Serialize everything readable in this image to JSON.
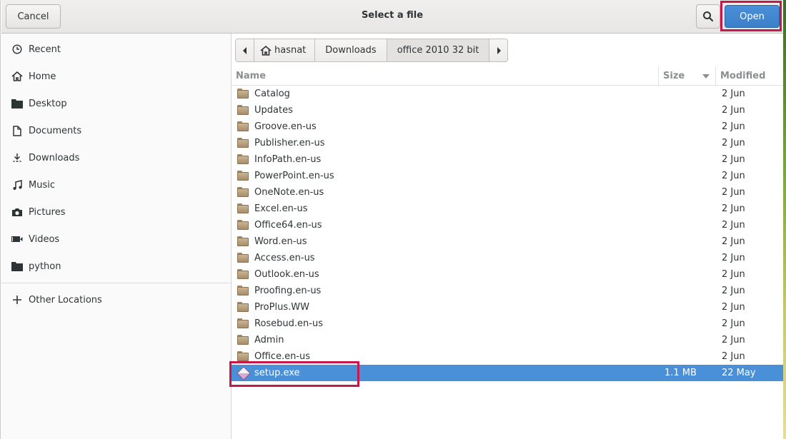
{
  "header": {
    "title": "Select a file",
    "cancel_label": "Cancel",
    "open_label": "Open",
    "search_icon": "search-icon"
  },
  "sidebar": {
    "items": [
      {
        "label": "Recent",
        "icon": "clock-icon"
      },
      {
        "label": "Home",
        "icon": "home-icon"
      },
      {
        "label": "Desktop",
        "icon": "folder-icon"
      },
      {
        "label": "Documents",
        "icon": "document-icon"
      },
      {
        "label": "Downloads",
        "icon": "download-icon"
      },
      {
        "label": "Music",
        "icon": "music-icon"
      },
      {
        "label": "Pictures",
        "icon": "camera-icon"
      },
      {
        "label": "Videos",
        "icon": "video-icon"
      },
      {
        "label": "python",
        "icon": "folder-icon"
      }
    ],
    "other_locations": {
      "label": "Other Locations",
      "icon": "plus-icon"
    }
  },
  "pathbar": {
    "crumbs": [
      "hasnat",
      "Downloads",
      "office 2010 32 bit"
    ]
  },
  "columns": {
    "name": "Name",
    "size": "Size",
    "modified": "Modified"
  },
  "files": [
    {
      "name": "Catalog",
      "size": "",
      "modified": "2 Jun",
      "type": "folder"
    },
    {
      "name": "Updates",
      "size": "",
      "modified": "2 Jun",
      "type": "folder"
    },
    {
      "name": "Groove.en-us",
      "size": "",
      "modified": "2 Jun",
      "type": "folder"
    },
    {
      "name": "Publisher.en-us",
      "size": "",
      "modified": "2 Jun",
      "type": "folder"
    },
    {
      "name": "InfoPath.en-us",
      "size": "",
      "modified": "2 Jun",
      "type": "folder"
    },
    {
      "name": "PowerPoint.en-us",
      "size": "",
      "modified": "2 Jun",
      "type": "folder"
    },
    {
      "name": "OneNote.en-us",
      "size": "",
      "modified": "2 Jun",
      "type": "folder"
    },
    {
      "name": "Excel.en-us",
      "size": "",
      "modified": "2 Jun",
      "type": "folder"
    },
    {
      "name": "Office64.en-us",
      "size": "",
      "modified": "2 Jun",
      "type": "folder"
    },
    {
      "name": "Word.en-us",
      "size": "",
      "modified": "2 Jun",
      "type": "folder"
    },
    {
      "name": "Access.en-us",
      "size": "",
      "modified": "2 Jun",
      "type": "folder"
    },
    {
      "name": "Outlook.en-us",
      "size": "",
      "modified": "2 Jun",
      "type": "folder"
    },
    {
      "name": "Proofing.en-us",
      "size": "",
      "modified": "2 Jun",
      "type": "folder"
    },
    {
      "name": "ProPlus.WW",
      "size": "",
      "modified": "2 Jun",
      "type": "folder"
    },
    {
      "name": "Rosebud.en-us",
      "size": "",
      "modified": "2 Jun",
      "type": "folder"
    },
    {
      "name": "Admin",
      "size": "",
      "modified": "2 Jun",
      "type": "folder"
    },
    {
      "name": "Office.en-us",
      "size": "",
      "modified": "2 Jun",
      "type": "folder"
    },
    {
      "name": "setup.exe",
      "size": "1.1 MB",
      "modified": "22 May",
      "type": "exe",
      "selected": true
    }
  ],
  "colors": {
    "selection": "#4a90d9",
    "highlight_box": "#c8174b"
  }
}
